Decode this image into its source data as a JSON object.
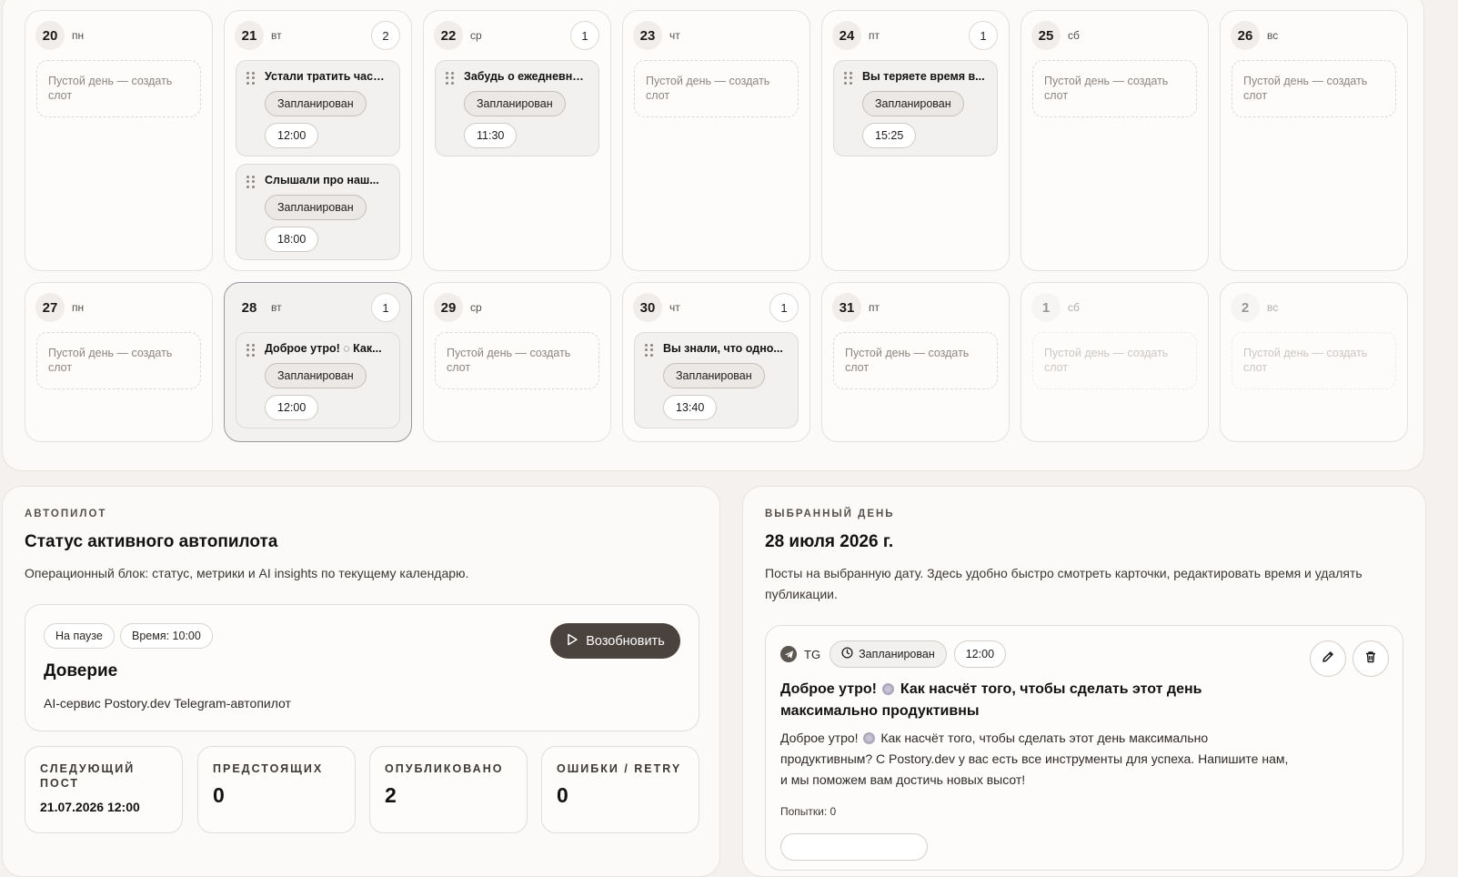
{
  "calendar": {
    "empty_label": "Пустой день — создать слот",
    "status_label": "Запланирован",
    "week1": [
      {
        "num": "20",
        "wd": "пн",
        "count": null,
        "posts": []
      },
      {
        "num": "21",
        "wd": "вт",
        "count": "2",
        "posts": [
          {
            "title": "Устали тратить часы ...",
            "time": "12:00"
          },
          {
            "title": "Слышали про наш...",
            "time": "18:00"
          }
        ]
      },
      {
        "num": "22",
        "wd": "ср",
        "count": "1",
        "posts": [
          {
            "title": "Забудь о ежедневны...",
            "time": "11:30"
          }
        ]
      },
      {
        "num": "23",
        "wd": "чт",
        "count": null,
        "posts": []
      },
      {
        "num": "24",
        "wd": "пт",
        "count": "1",
        "posts": [
          {
            "title": "Вы теряете время в...",
            "time": "15:25"
          }
        ]
      },
      {
        "num": "25",
        "wd": "сб",
        "count": null,
        "posts": []
      },
      {
        "num": "26",
        "wd": "вс",
        "count": null,
        "posts": []
      }
    ],
    "week2": [
      {
        "num": "27",
        "wd": "пн",
        "count": null,
        "posts": []
      },
      {
        "num": "28",
        "wd": "вт",
        "count": "1",
        "selected": true,
        "posts": [
          {
            "title": "Доброе утро! ◌ Как...",
            "time": "12:00"
          }
        ]
      },
      {
        "num": "29",
        "wd": "ср",
        "count": null,
        "posts": []
      },
      {
        "num": "30",
        "wd": "чт",
        "count": "1",
        "posts": [
          {
            "title": "Вы знали, что одно...",
            "time": "13:40"
          }
        ]
      },
      {
        "num": "31",
        "wd": "пт",
        "count": null,
        "posts": []
      },
      {
        "num": "1",
        "wd": "сб",
        "count": null,
        "muted": true,
        "posts": []
      },
      {
        "num": "2",
        "wd": "вс",
        "count": null,
        "muted": true,
        "posts": []
      }
    ]
  },
  "autopilot": {
    "eyebrow": "АВТОПИЛОТ",
    "title": "Статус активного автопилота",
    "description": "Операционный блок: статус, метрики и AI insights по текущему календарю.",
    "status_tag": "На паузе",
    "time_tag": "Время: 10:00",
    "resume_label": "Возобновить",
    "name": "Доверие",
    "subtitle": "AI-сервис Postory.dev Telegram-автопилот",
    "metrics": [
      {
        "label": "Следующий пост",
        "value": "21.07.2026 12:00"
      },
      {
        "label": "Предстоящих",
        "value": "0"
      },
      {
        "label": "Опубликовано",
        "value": "2"
      },
      {
        "label": "Ошибки / retry",
        "value": "0"
      }
    ]
  },
  "selected_day": {
    "eyebrow": "ВЫБРАННЫЙ ДЕНЬ",
    "title": "28 июля 2026 г.",
    "description": "Посты на выбранную дату. Здесь удобно быстро смотреть карточки, редактировать время и удалять публикации.",
    "post": {
      "channel": "TG",
      "status": "Запланирован",
      "time": "12:00",
      "title_a": "Доброе утро!",
      "title_b": "Как насчёт того, чтобы сделать этот день максимально продуктивны",
      "body_a": "Доброе утро!",
      "body_b": "Как насчёт того, чтобы сделать этот день максимально продуктивным? С Postory.dev у вас есть все инструменты для успеха. Напишите нам, и мы поможем вам достичь новых высот!",
      "attempts": "Попытки: 0"
    }
  },
  "colors": {
    "accent_button": "#4a423c",
    "page_bg": "#f4f1ee",
    "panel_bg": "#fbfaf8"
  }
}
